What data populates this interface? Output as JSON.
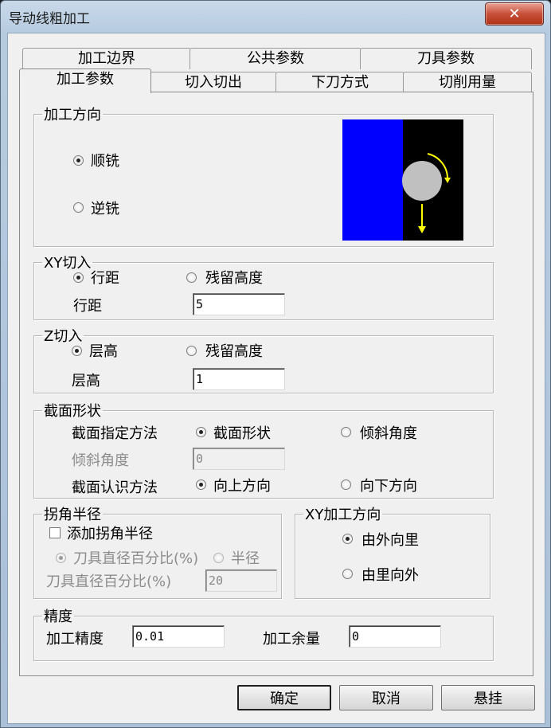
{
  "window": {
    "title": "导动线粗加工",
    "close_glyph": "✕"
  },
  "tabs_back": [
    {
      "label": "加工边界"
    },
    {
      "label": "公共参数"
    },
    {
      "label": "刀具参数"
    }
  ],
  "tabs_front": [
    {
      "label": "加工参数",
      "active": true
    },
    {
      "label": "切入切出"
    },
    {
      "label": "下刀方式"
    },
    {
      "label": "切削用量"
    }
  ],
  "machining_direction": {
    "legend": "加工方向",
    "climb": "顺铣",
    "conventional": "逆铣",
    "selected": "climb",
    "preview_colors": {
      "material": "#0000ff",
      "background": "#000000",
      "tool": "#c0c0c0",
      "arrow": "#ffff00"
    }
  },
  "xy_feed": {
    "legend": "XY切入",
    "opt_pitch": "行距",
    "opt_residual": "残留高度",
    "field_label": "行距",
    "value": "5"
  },
  "z_feed": {
    "legend": "Z切入",
    "opt_layer": "层高",
    "opt_residual": "残留高度",
    "field_label": "层高",
    "value": "1"
  },
  "section_shape": {
    "legend": "截面形状",
    "spec_label": "截面指定方法",
    "spec_opt_shape": "截面形状",
    "spec_opt_angle": "倾斜角度",
    "angle_label": "倾斜角度",
    "angle_value": "0",
    "recog_label": "截面认识方法",
    "recog_opt_up": "向上方向",
    "recog_opt_down": "向下方向"
  },
  "corner_radius": {
    "legend": "拐角半径",
    "add_label": "添加拐角半径",
    "opt_percent": "刀具直径百分比(%)",
    "opt_radius": "半径",
    "field_label": "刀具直径百分比(%)",
    "value": "20"
  },
  "xy_direction": {
    "legend": "XY加工方向",
    "opt_outside_in": "由外向里",
    "opt_inside_out": "由里向外"
  },
  "precision": {
    "legend": "精度",
    "tolerance_label": "加工精度",
    "tolerance_value": "0.01",
    "allowance_label": "加工余量",
    "allowance_value": "0"
  },
  "buttons": {
    "ok": "确定",
    "cancel": "取消",
    "suspend": "悬挂"
  }
}
